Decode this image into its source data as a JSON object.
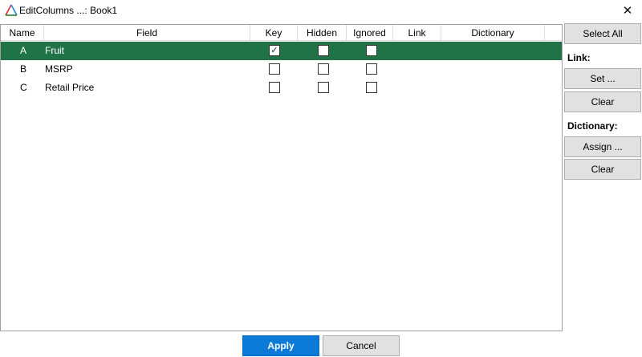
{
  "window": {
    "title": "EditColumns ...: Book1",
    "close_glyph": "✕"
  },
  "table": {
    "columns": [
      "Name",
      "Field",
      "Key",
      "Hidden",
      "Ignored",
      "Link",
      "Dictionary"
    ],
    "rows": [
      {
        "name": "A",
        "field": "Fruit",
        "key": true,
        "hidden": false,
        "ignored": false,
        "link": "",
        "dictionary": "",
        "selected": true
      },
      {
        "name": "B",
        "field": "MSRP",
        "key": false,
        "hidden": false,
        "ignored": false,
        "link": "",
        "dictionary": "",
        "selected": false
      },
      {
        "name": "C",
        "field": "Retail Price",
        "key": false,
        "hidden": false,
        "ignored": false,
        "link": "",
        "dictionary": "",
        "selected": false
      }
    ]
  },
  "side": {
    "select_all": "Select All",
    "link_label": "Link:",
    "link_set": "Set ...",
    "link_clear": "Clear",
    "dictionary_label": "Dictionary:",
    "dictionary_assign": "Assign ...",
    "dictionary_clear": "Clear"
  },
  "footer": {
    "apply": "Apply",
    "cancel": "Cancel"
  },
  "colors": {
    "selected_row": "#207346",
    "apply_button": "#0b7ad6",
    "button_face": "#e1e1e1"
  },
  "icons": {
    "app": "triangle-logo-icon",
    "close": "close-icon",
    "check": "checkmark-icon"
  }
}
